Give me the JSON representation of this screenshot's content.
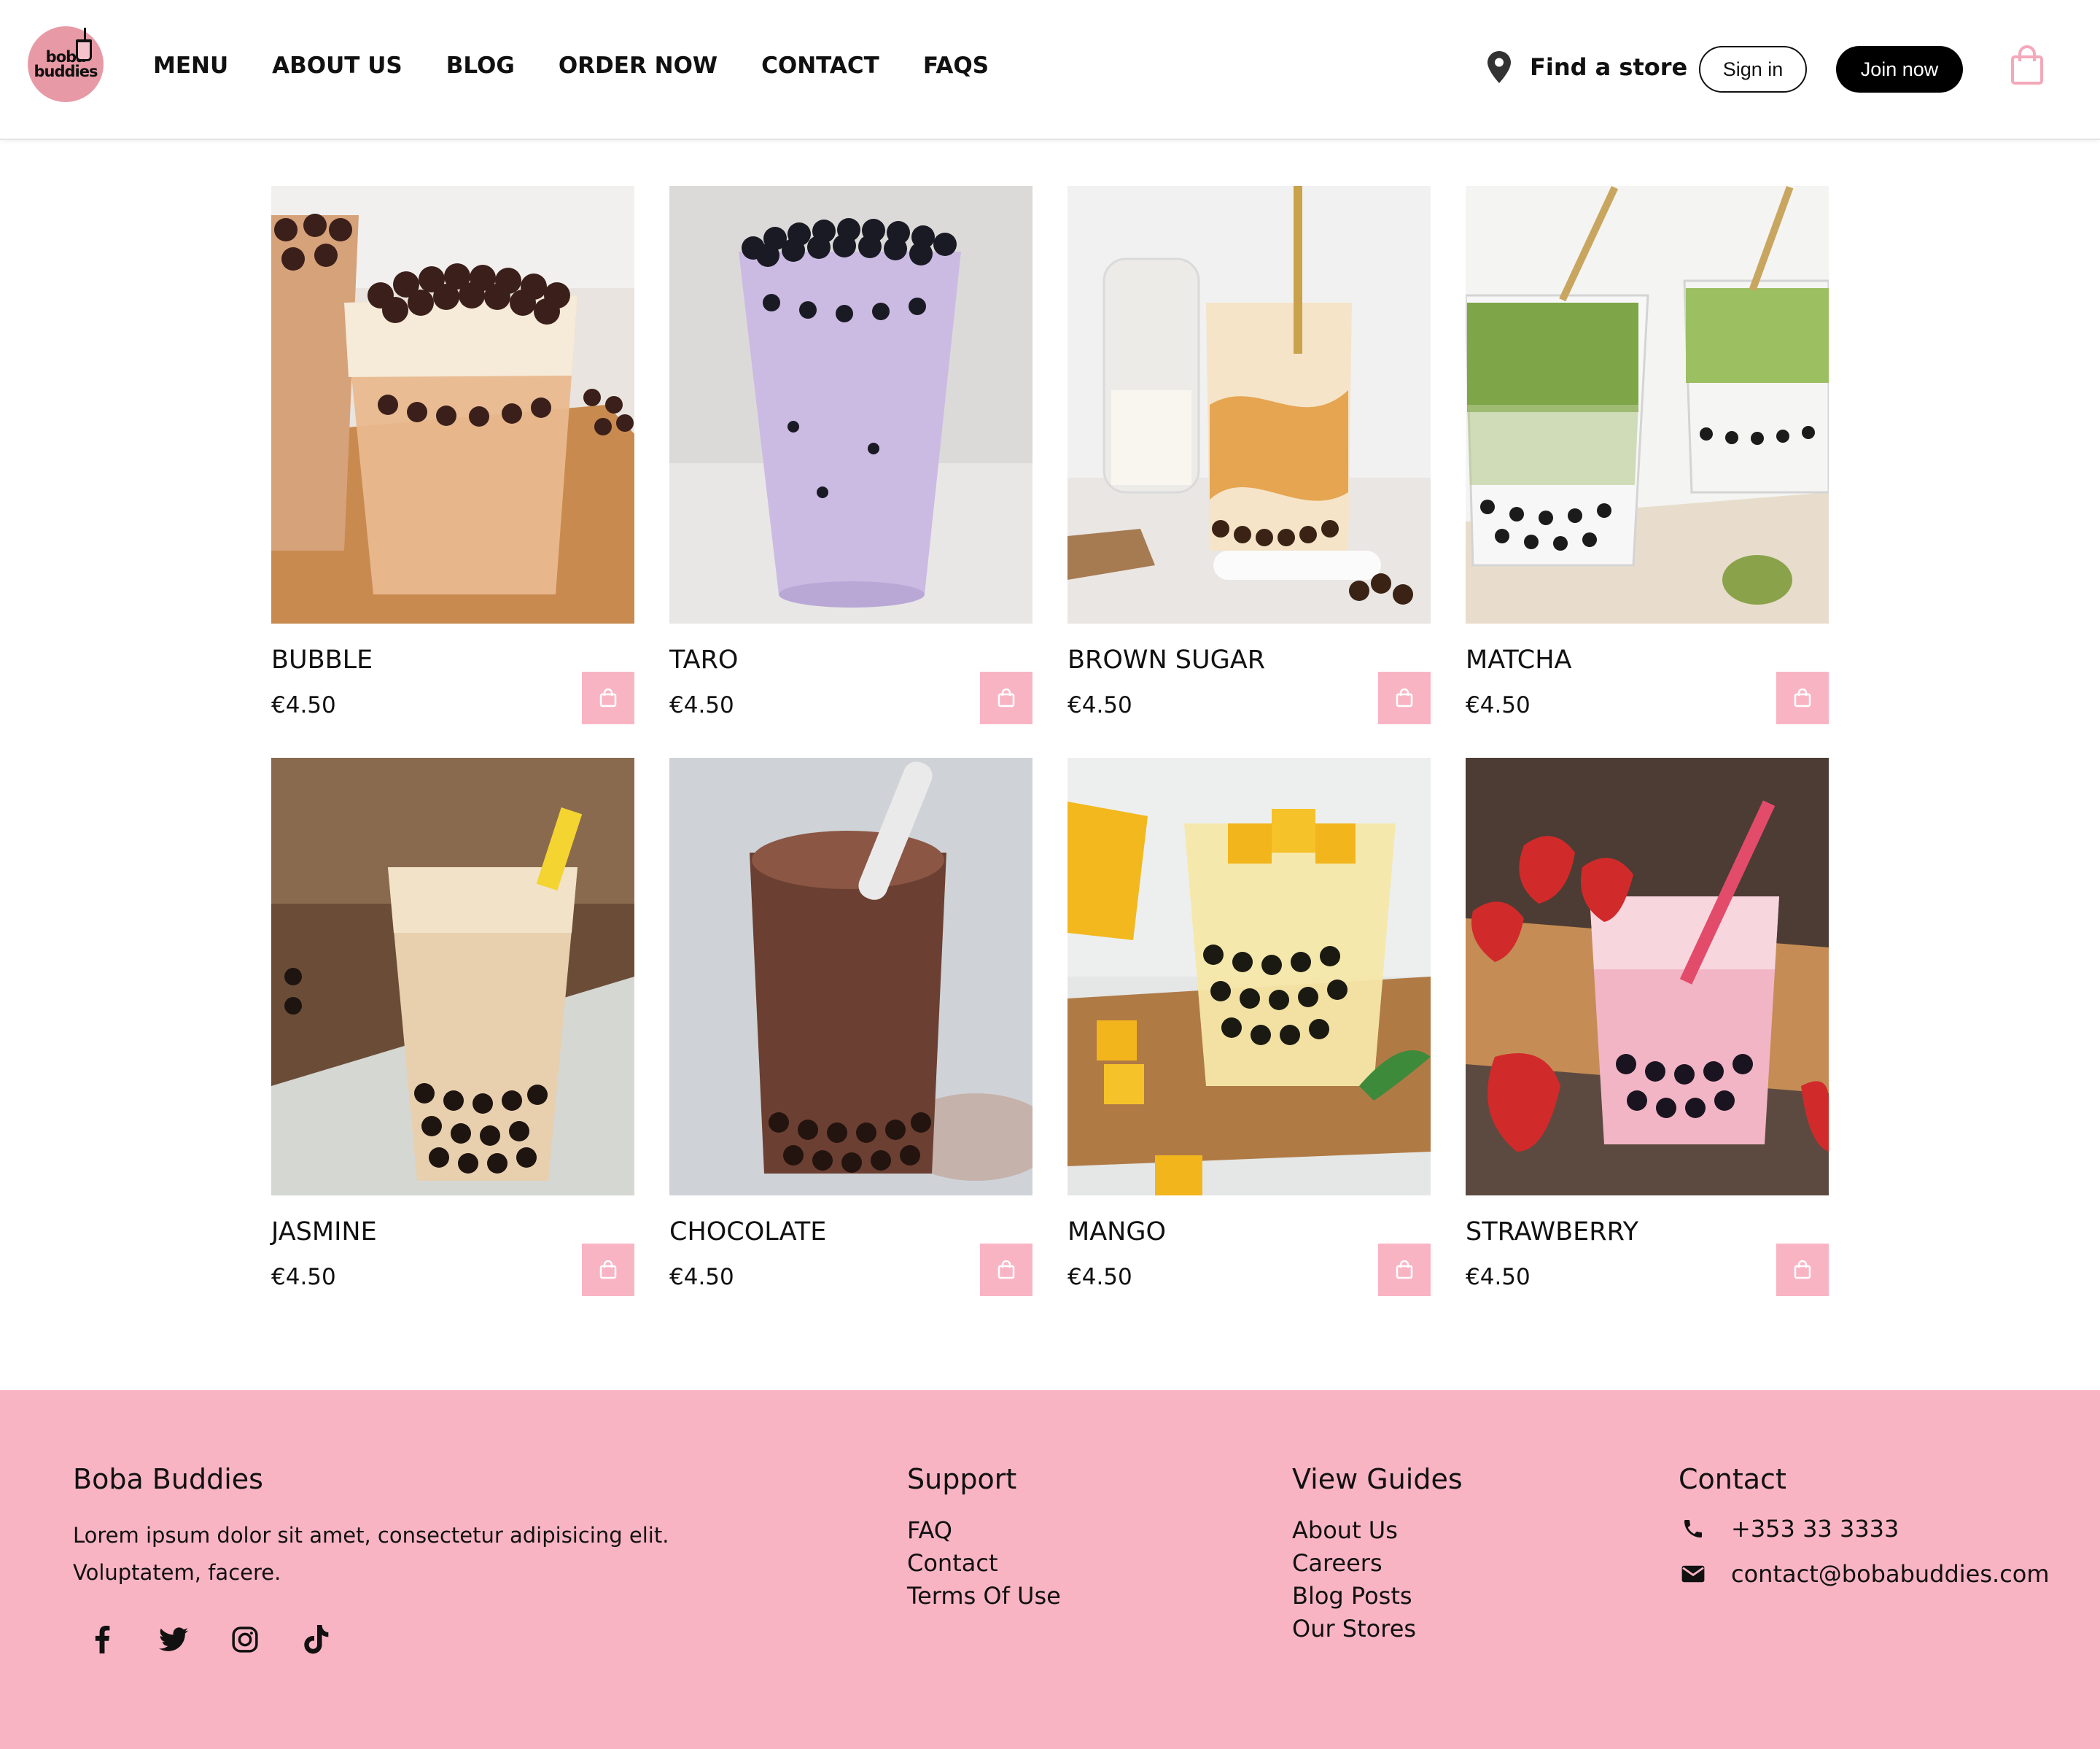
{
  "brand": {
    "logo_text": "boba\nbuddies",
    "accent_color": "#f9b4c4",
    "logo_color": "#e79aa6"
  },
  "nav": {
    "items": [
      {
        "label": "MENU"
      },
      {
        "label": "ABOUT US"
      },
      {
        "label": "BLOG"
      },
      {
        "label": "ORDER NOW"
      },
      {
        "label": "CONTACT"
      },
      {
        "label": "FAQS"
      }
    ],
    "find_store": "Find a store",
    "sign_in": "Sign in",
    "join_now": "Join now",
    "cart_icon": "shopping-bag-icon"
  },
  "products": [
    {
      "name": "BUBBLE",
      "price": "€4.50",
      "drink_color": "#d9a57a"
    },
    {
      "name": "TARO",
      "price": "€4.50",
      "drink_color": "#c9b6dc"
    },
    {
      "name": "BROWN SUGAR",
      "price": "€4.50",
      "drink_color": "#e7b06a"
    },
    {
      "name": "MATCHA",
      "price": "€4.50",
      "drink_color": "#8fb45a"
    },
    {
      "name": "JASMINE",
      "price": "€4.50",
      "drink_color": "#e5c9a8"
    },
    {
      "name": "CHOCOLATE",
      "price": "€4.50",
      "drink_color": "#7a4a3a"
    },
    {
      "name": "MANGO",
      "price": "€4.50",
      "drink_color": "#f1d98a"
    },
    {
      "name": "STRAWBERRY",
      "price": "€4.50",
      "drink_color": "#f3b8c8"
    }
  ],
  "footer": {
    "brand_title": "Boba Buddies",
    "brand_text_1": "Lorem ipsum dolor sit amet, consectetur adipisicing elit.",
    "brand_text_2": "Voluptatem, facere.",
    "social": [
      "facebook-icon",
      "twitter-icon",
      "instagram-icon",
      "tiktok-icon"
    ],
    "support": {
      "title": "Support",
      "links": [
        "FAQ",
        "Contact",
        "Terms Of Use"
      ]
    },
    "guides": {
      "title": "View Guides",
      "links": [
        "About Us",
        "Careers",
        "Blog Posts",
        "Our Stores"
      ]
    },
    "contact": {
      "title": "Contact",
      "phone": "+353 33 3333",
      "email": "contact@bobabuddies.com"
    }
  }
}
